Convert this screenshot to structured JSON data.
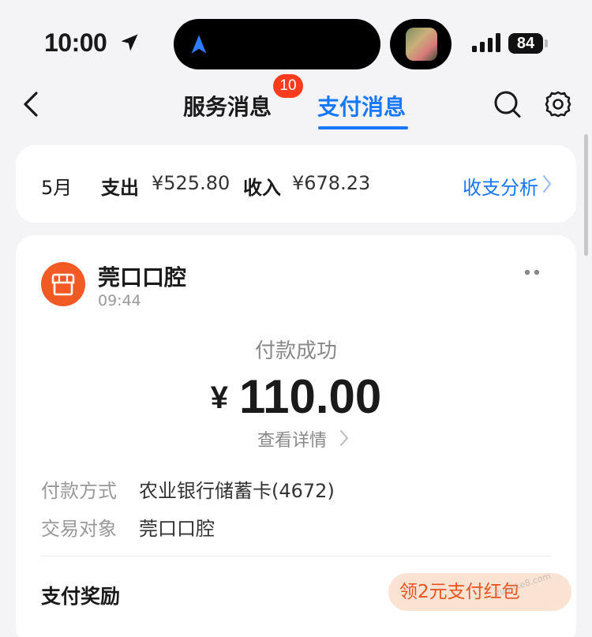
{
  "status_bar": {
    "time": "10:00",
    "battery": "84"
  },
  "nav": {
    "tabs": [
      {
        "label": "服务消息",
        "badge": "10",
        "active": false
      },
      {
        "label": "支付消息",
        "active": true
      }
    ],
    "accent_color": "#1677ff",
    "badge_color": "#ff3b1f"
  },
  "summary": {
    "month": "5月",
    "expense_label": "支出",
    "expense_value": "¥525.80",
    "income_label": "收入",
    "income_value": "¥678.23",
    "analysis_label": "收支分析"
  },
  "message": {
    "merchant_name": "莞口口腔",
    "time": "09:44",
    "status": "付款成功",
    "currency": "¥",
    "amount": "110.00",
    "detail_link": "查看详情",
    "rows": [
      {
        "label": "付款方式",
        "value": "农业银行储蓄卡(4672)"
      },
      {
        "label": "交易对象",
        "value": "莞口口腔"
      }
    ],
    "reward_label": "支付奖励",
    "reward_button": "领2元支付红包",
    "logo_color": "#f15a24",
    "watermark": "zuanke8.com"
  }
}
